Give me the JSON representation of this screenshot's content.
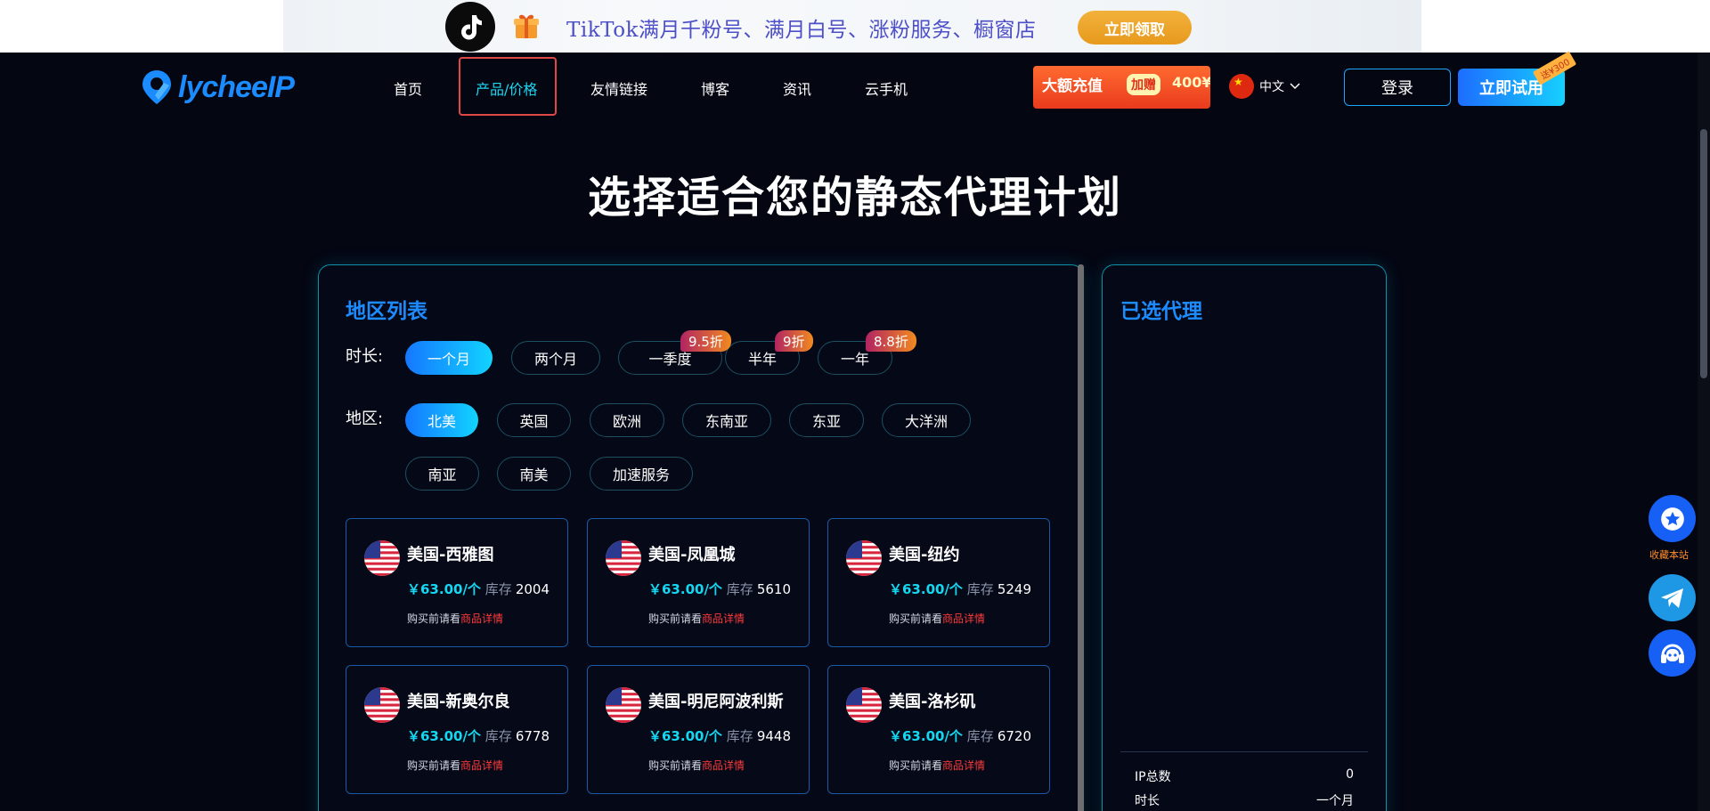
{
  "banner": {
    "text": "TikTok满月千粉号、满月白号、涨粉服务、橱窗店",
    "button": "立即领取"
  },
  "nav": {
    "logo": "lycheeIP",
    "items": [
      "首页",
      "产品/价格",
      "友情链接",
      "博客",
      "资讯",
      "云手机"
    ],
    "active_index": 1,
    "promo": {
      "text": "大额充值",
      "tag": "加赠",
      "amount": "400¥"
    },
    "language": "中文",
    "login": "登录",
    "try": "立即试用",
    "try_badge": "送¥300"
  },
  "page_title": "选择适合您的静态代理计划",
  "region_panel": {
    "title": "地区列表",
    "duration_label": "时长:",
    "durations": [
      {
        "label": "一个月",
        "active": true,
        "discount": ""
      },
      {
        "label": "两个月",
        "active": false,
        "discount": ""
      },
      {
        "label": "一季度",
        "active": false,
        "discount": "9.5折"
      },
      {
        "label": "半年",
        "active": false,
        "discount": "9折"
      },
      {
        "label": "一年",
        "active": false,
        "discount": "8.8折"
      }
    ],
    "region_label": "地区:",
    "regions": [
      {
        "label": "北美",
        "active": true
      },
      {
        "label": "英国",
        "active": false
      },
      {
        "label": "欧洲",
        "active": false
      },
      {
        "label": "东南亚",
        "active": false
      },
      {
        "label": "东亚",
        "active": false
      },
      {
        "label": "大洋洲",
        "active": false
      },
      {
        "label": "南亚",
        "active": false
      },
      {
        "label": "南美",
        "active": false
      },
      {
        "label": "加速服务",
        "active": false
      }
    ],
    "cards": [
      {
        "name": "美国-西雅图",
        "price": "￥63.00/个",
        "stock_label": "库存",
        "stock": "2004",
        "note": "购买前请看",
        "link": "商品详情"
      },
      {
        "name": "美国-凤凰城",
        "price": "￥63.00/个",
        "stock_label": "库存",
        "stock": "5610",
        "note": "购买前请看",
        "link": "商品详情"
      },
      {
        "name": "美国-纽约",
        "price": "￥63.00/个",
        "stock_label": "库存",
        "stock": "5249",
        "note": "购买前请看",
        "link": "商品详情"
      },
      {
        "name": "美国-新奥尔良",
        "price": "￥63.00/个",
        "stock_label": "库存",
        "stock": "6778",
        "note": "购买前请看",
        "link": "商品详情"
      },
      {
        "name": "美国-明尼阿波利斯",
        "price": "￥63.00/个",
        "stock_label": "库存",
        "stock": "9448",
        "note": "购买前请看",
        "link": "商品详情"
      },
      {
        "name": "美国-洛杉矶",
        "price": "￥63.00/个",
        "stock_label": "库存",
        "stock": "6720",
        "note": "购买前请看",
        "link": "商品详情"
      }
    ]
  },
  "selected_panel": {
    "title": "已选代理",
    "ip_total_label": "IP总数",
    "ip_total": "0",
    "duration_label": "时长",
    "duration": "一个月"
  },
  "float": {
    "favorite_label": "收藏本站",
    "icons": [
      "star-icon",
      "telegram-icon",
      "headset-icon"
    ]
  },
  "colors": {
    "accent": "#1c8cff",
    "active_gradient_start": "#1478ff",
    "active_gradient_end": "#12d3ff",
    "price": "#14d8f2",
    "link_red": "#ff3b3b"
  }
}
